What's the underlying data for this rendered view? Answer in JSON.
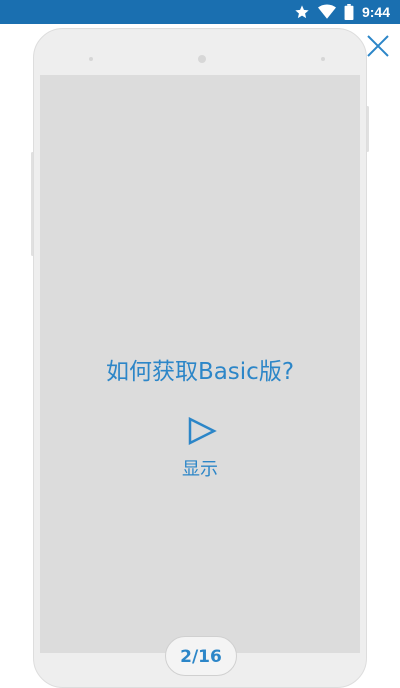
{
  "status_bar": {
    "time": "9:44",
    "icons": [
      "star-icon",
      "wifi-icon",
      "battery-icon"
    ],
    "bg_color": "#1a6fb0"
  },
  "close": {
    "icon": "close-icon"
  },
  "slide": {
    "question": "如何获取Basic版?",
    "play_icon": "play-icon",
    "show_label": "显示"
  },
  "pager": {
    "label": "2/16"
  },
  "colors": {
    "accent": "#2c86c8",
    "screen": "#dcdcdc"
  }
}
